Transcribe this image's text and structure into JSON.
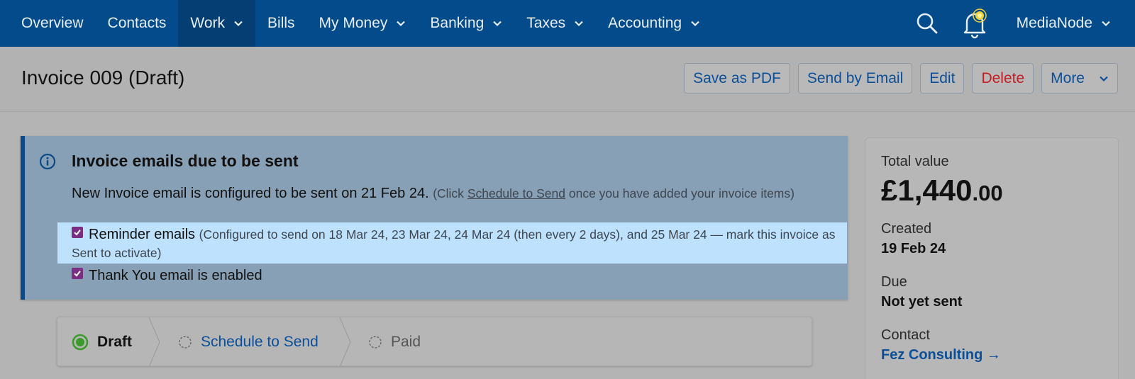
{
  "nav": {
    "items": [
      {
        "label": "Overview",
        "has_dropdown": false
      },
      {
        "label": "Contacts",
        "has_dropdown": false
      },
      {
        "label": "Work",
        "has_dropdown": true,
        "active": true
      },
      {
        "label": "Bills",
        "has_dropdown": false
      },
      {
        "label": "My Money",
        "has_dropdown": true
      },
      {
        "label": "Banking",
        "has_dropdown": true
      },
      {
        "label": "Taxes",
        "has_dropdown": true
      },
      {
        "label": "Accounting",
        "has_dropdown": true
      }
    ],
    "icons": [
      "search-icon",
      "bell-icon"
    ],
    "user_label": "MediaNode"
  },
  "header": {
    "title": "Invoice 009 (Draft)",
    "actions": {
      "save_pdf": "Save as PDF",
      "send_email": "Send by Email",
      "edit": "Edit",
      "delete": "Delete",
      "more": "More"
    }
  },
  "notice": {
    "title": "Invoice emails due to be sent",
    "line1_main": "New Invoice email is configured to be sent on 21 Feb 24.",
    "line1_pre": "(Click",
    "line1_link": "Schedule to Send",
    "line1_post": "once you have added your invoice items)",
    "reminder_label": "Reminder emails",
    "reminder_note": "(Configured to send on 18 Mar 24, 23 Mar 24, 24 Mar 24 (then every 2 days), and 25 Mar 24 — mark this invoice as Sent to activate)",
    "reminder_checked": true,
    "thanks_label": "Thank You email is enabled",
    "thanks_checked": true
  },
  "steps": {
    "draft": "Draft",
    "schedule": "Schedule to Send",
    "paid": "Paid"
  },
  "summary": {
    "total_label": "Total value",
    "total_major": "£1,440",
    "total_minor": ".00",
    "created_label": "Created",
    "created_value": "19 Feb 24",
    "due_label": "Due",
    "due_value": "Not yet sent",
    "contact_label": "Contact",
    "contact_value": "Fez Consulting →"
  },
  "colors": {
    "nav_bg": "#034b8a",
    "nav_active": "#053e72",
    "link": "#0b4f98",
    "danger": "#c31d24",
    "checkbox": "#7b2f82",
    "highlight": "#bee2fe",
    "step_active": "#3a9a2a"
  }
}
